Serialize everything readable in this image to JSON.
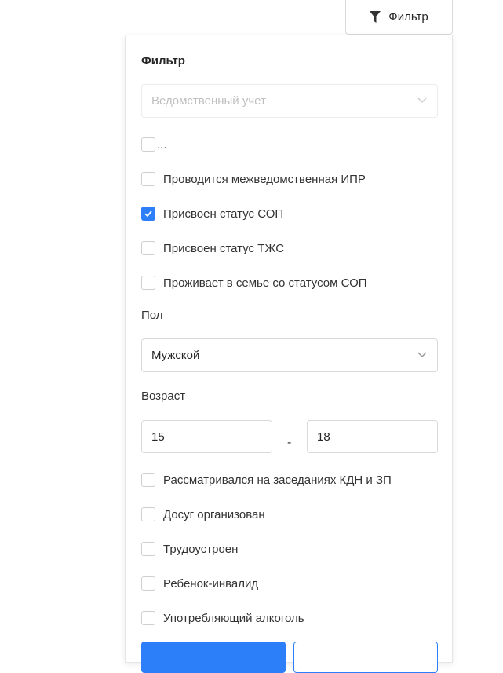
{
  "toolbar": {
    "filter_label": "Фильтр"
  },
  "panel": {
    "title": "Фильтр",
    "department_select": {
      "placeholder": "Ведомственный учет"
    },
    "checkboxes_top": [
      {
        "label": "...",
        "checked": false
      },
      {
        "label": "Проводится межведомственная ИПР",
        "checked": false
      },
      {
        "label": "Присвоен статус СОП",
        "checked": true
      },
      {
        "label": "Присвоен статус ТЖС",
        "checked": false
      },
      {
        "label": "Проживает в семье со статусом СОП",
        "checked": false
      }
    ],
    "gender": {
      "label": "Пол",
      "value": "Мужской"
    },
    "age": {
      "label": "Возраст",
      "from": "15",
      "separator": "-",
      "to": "18"
    },
    "checkboxes_bottom": [
      {
        "label": "Рассматривался на заседаниях КДН и ЗП",
        "checked": false
      },
      {
        "label": "Досуг организован",
        "checked": false
      },
      {
        "label": "Трудоустроен",
        "checked": false
      },
      {
        "label": "Ребенок-инвалид",
        "checked": false
      },
      {
        "label": "Употребляющий алкоголь",
        "checked": false
      }
    ]
  },
  "colors": {
    "accent": "#2d7ff9",
    "border": "#d9d9d9",
    "text": "#262626",
    "placeholder": "#bfbfbf"
  }
}
